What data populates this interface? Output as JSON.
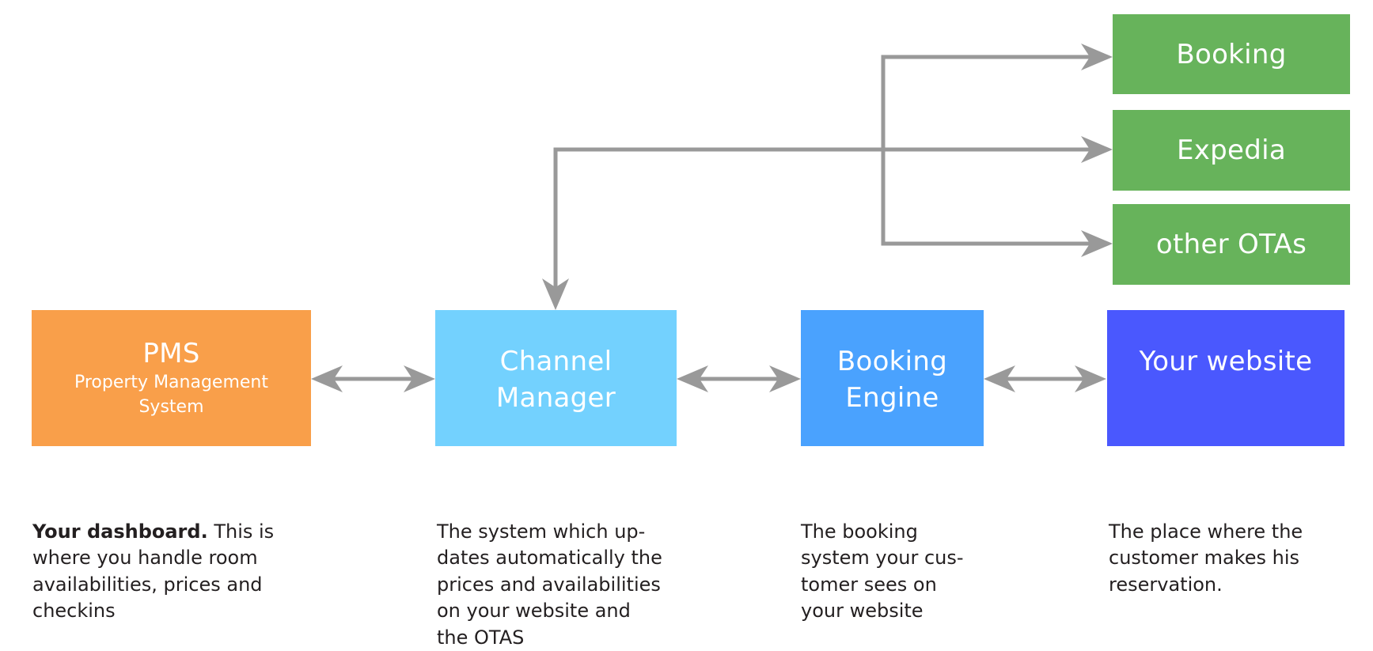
{
  "diagram": {
    "colors": {
      "pms": "#f99f4a",
      "channel_manager": "#73d1fe",
      "booking_engine": "#4aa2fe",
      "your_website": "#4a58fe",
      "ota": "#67b35b",
      "arrow": "#999999",
      "text": "#231f20"
    },
    "nodes": {
      "pms": {
        "title": "PMS",
        "subtitle_line1": "Property Management",
        "subtitle_line2": "System"
      },
      "channel_manager": {
        "title_line1": "Channel",
        "title_line2": "Manager"
      },
      "booking_engine": {
        "title_line1": "Booking",
        "title_line2": "Engine"
      },
      "your_website": {
        "title": "Your website"
      },
      "booking": {
        "title": "Booking"
      },
      "expedia": {
        "title": "Expedia"
      },
      "other_otas": {
        "title": "other OTAs"
      }
    },
    "edges": [
      {
        "from": "pms",
        "to": "channel_manager",
        "direction": "both"
      },
      {
        "from": "channel_manager",
        "to": "booking_engine",
        "direction": "both"
      },
      {
        "from": "booking_engine",
        "to": "your_website",
        "direction": "both"
      },
      {
        "from": "channel_manager",
        "to": "booking",
        "direction": "both"
      },
      {
        "from": "channel_manager",
        "to": "expedia",
        "direction": "both"
      },
      {
        "from": "channel_manager",
        "to": "other_otas",
        "direction": "both"
      }
    ],
    "descriptions": {
      "pms": {
        "bold": "Your dashboard.",
        "text": " This is where you handle room availabilities, prices and checkins"
      },
      "channel_manager": {
        "text": "The system which up-\ndates automatically the\nprices and availabilities\non your website and\nthe OTAS"
      },
      "booking_engine": {
        "text": "The booking\nsystem your cus-\ntomer sees on\nyour website"
      },
      "your_website": {
        "text": "The place where the\ncustomer makes his\nreservation."
      }
    }
  }
}
